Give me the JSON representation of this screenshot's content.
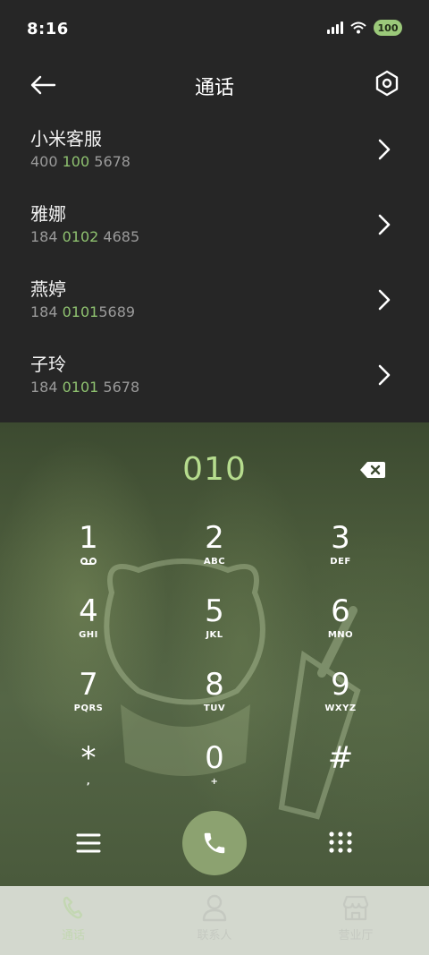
{
  "status": {
    "time": "8:16",
    "battery": "100"
  },
  "header": {
    "title": "通话"
  },
  "results": [
    {
      "name": "小米客服",
      "number_parts": [
        "400 ",
        "100",
        " 5678"
      ]
    },
    {
      "name": "雅娜",
      "number_parts": [
        "184 ",
        "0102",
        " 4685"
      ]
    },
    {
      "name": "燕婷",
      "number_parts": [
        "184 ",
        "0101",
        "5689"
      ]
    },
    {
      "name": "子玲",
      "number_parts": [
        "184 ",
        "0101",
        " 5678"
      ]
    }
  ],
  "dialer": {
    "digits": "010",
    "keys": [
      {
        "num": "1",
        "sub": ""
      },
      {
        "num": "2",
        "sub": "ABC"
      },
      {
        "num": "3",
        "sub": "DEF"
      },
      {
        "num": "4",
        "sub": "GHI"
      },
      {
        "num": "5",
        "sub": "JKL"
      },
      {
        "num": "6",
        "sub": "MNO"
      },
      {
        "num": "7",
        "sub": "PQRS"
      },
      {
        "num": "8",
        "sub": "TUV"
      },
      {
        "num": "9",
        "sub": "WXYZ"
      },
      {
        "num": "*",
        "sub": ","
      },
      {
        "num": "0",
        "sub": "+"
      },
      {
        "num": "#",
        "sub": ""
      }
    ]
  },
  "tabs": [
    {
      "label": "通话",
      "icon": "phone-icon",
      "active": true
    },
    {
      "label": "联系人",
      "icon": "person-icon",
      "active": false
    },
    {
      "label": "营业厅",
      "icon": "store-icon",
      "active": false
    }
  ],
  "colors": {
    "accent": "#8fc270",
    "digits": "#b6dc8e",
    "call": "#8ca270",
    "tab_bar": "#d3d8ce"
  }
}
